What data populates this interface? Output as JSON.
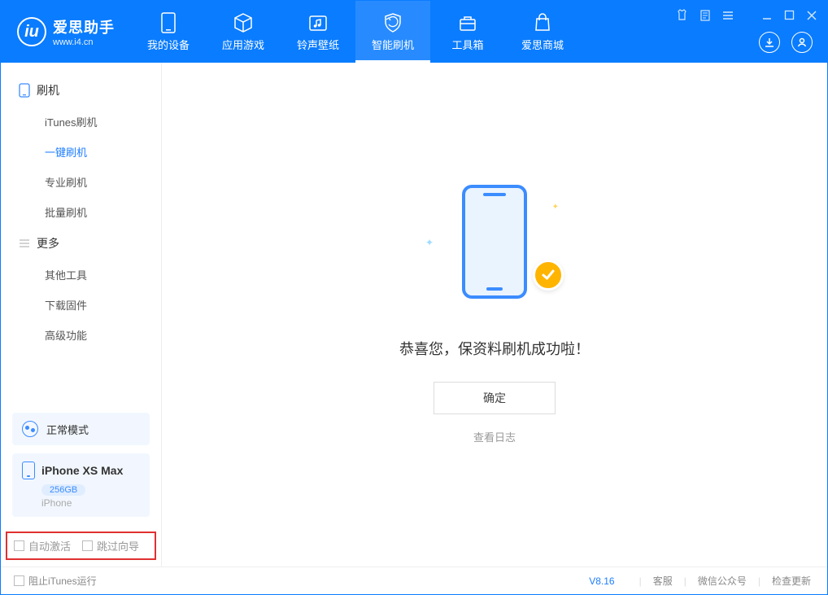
{
  "app": {
    "name": "爱思助手",
    "url": "www.i4.cn"
  },
  "nav": {
    "items": [
      {
        "label": "我的设备"
      },
      {
        "label": "应用游戏"
      },
      {
        "label": "铃声壁纸"
      },
      {
        "label": "智能刷机"
      },
      {
        "label": "工具箱"
      },
      {
        "label": "爱思商城"
      }
    ]
  },
  "sidebar": {
    "section1": "刷机",
    "items1": [
      "iTunes刷机",
      "一键刷机",
      "专业刷机",
      "批量刷机"
    ],
    "section2": "更多",
    "items2": [
      "其他工具",
      "下载固件",
      "高级功能"
    ]
  },
  "mode": {
    "label": "正常模式"
  },
  "device": {
    "name": "iPhone XS Max",
    "storage": "256GB",
    "type": "iPhone"
  },
  "options": {
    "auto_activate": "自动激活",
    "skip_guide": "跳过向导"
  },
  "main": {
    "success": "恭喜您，保资料刷机成功啦！",
    "ok": "确定",
    "view_log": "查看日志"
  },
  "status": {
    "block_itunes": "阻止iTunes运行",
    "version": "V8.16",
    "links": [
      "客服",
      "微信公众号",
      "检查更新"
    ]
  }
}
